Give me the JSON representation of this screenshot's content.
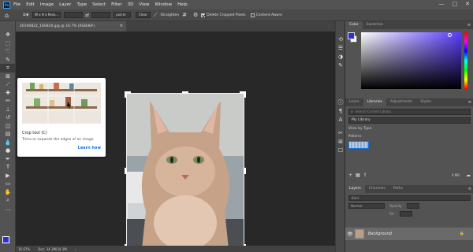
{
  "app": {
    "logo": "Ps"
  },
  "menu": [
    "File",
    "Edit",
    "Image",
    "Layer",
    "Type",
    "Select",
    "Filter",
    "3D",
    "View",
    "Window",
    "Help"
  ],
  "window_controls": {
    "minimize": "—",
    "maximize": "□",
    "close": "✕"
  },
  "options_bar": {
    "ratio": "W x H x Reso...",
    "unit": "px/cm",
    "clear": "Clear",
    "straighten": "Straighten",
    "delete_cropped": "Delete Cropped Pixels",
    "content_aware": "Content-Aware"
  },
  "document": {
    "tab_title": "20190822_160820.jpg @ 16.7% (RGB/8#)",
    "close": "×"
  },
  "tooltip": {
    "title": "Crop tool (C)",
    "description": "Trims or expands the edges of an image",
    "link": "Learn how"
  },
  "status": {
    "zoom": "16.67%",
    "doc": "Doc: 34.3M/34.3M"
  },
  "color_panel": {
    "tabs": [
      "Color",
      "Swatches"
    ],
    "fg": "#2d2fd6",
    "bg": "#ffffff"
  },
  "libraries_panel": {
    "tabs": [
      "Learn",
      "Libraries",
      "Adjustments",
      "Styles"
    ],
    "search_placeholder": "Search Current Library",
    "library": "My Library",
    "view_by": "View by Type",
    "section": "Patterns",
    "size": "4 MB"
  },
  "layers_panel": {
    "tabs": [
      "Layers",
      "Channels",
      "Paths"
    ],
    "kind": "Kind",
    "blend": "Normal",
    "opacity_label": "Opacity:",
    "fill_label": "Fill:",
    "layer_name": "Background"
  }
}
